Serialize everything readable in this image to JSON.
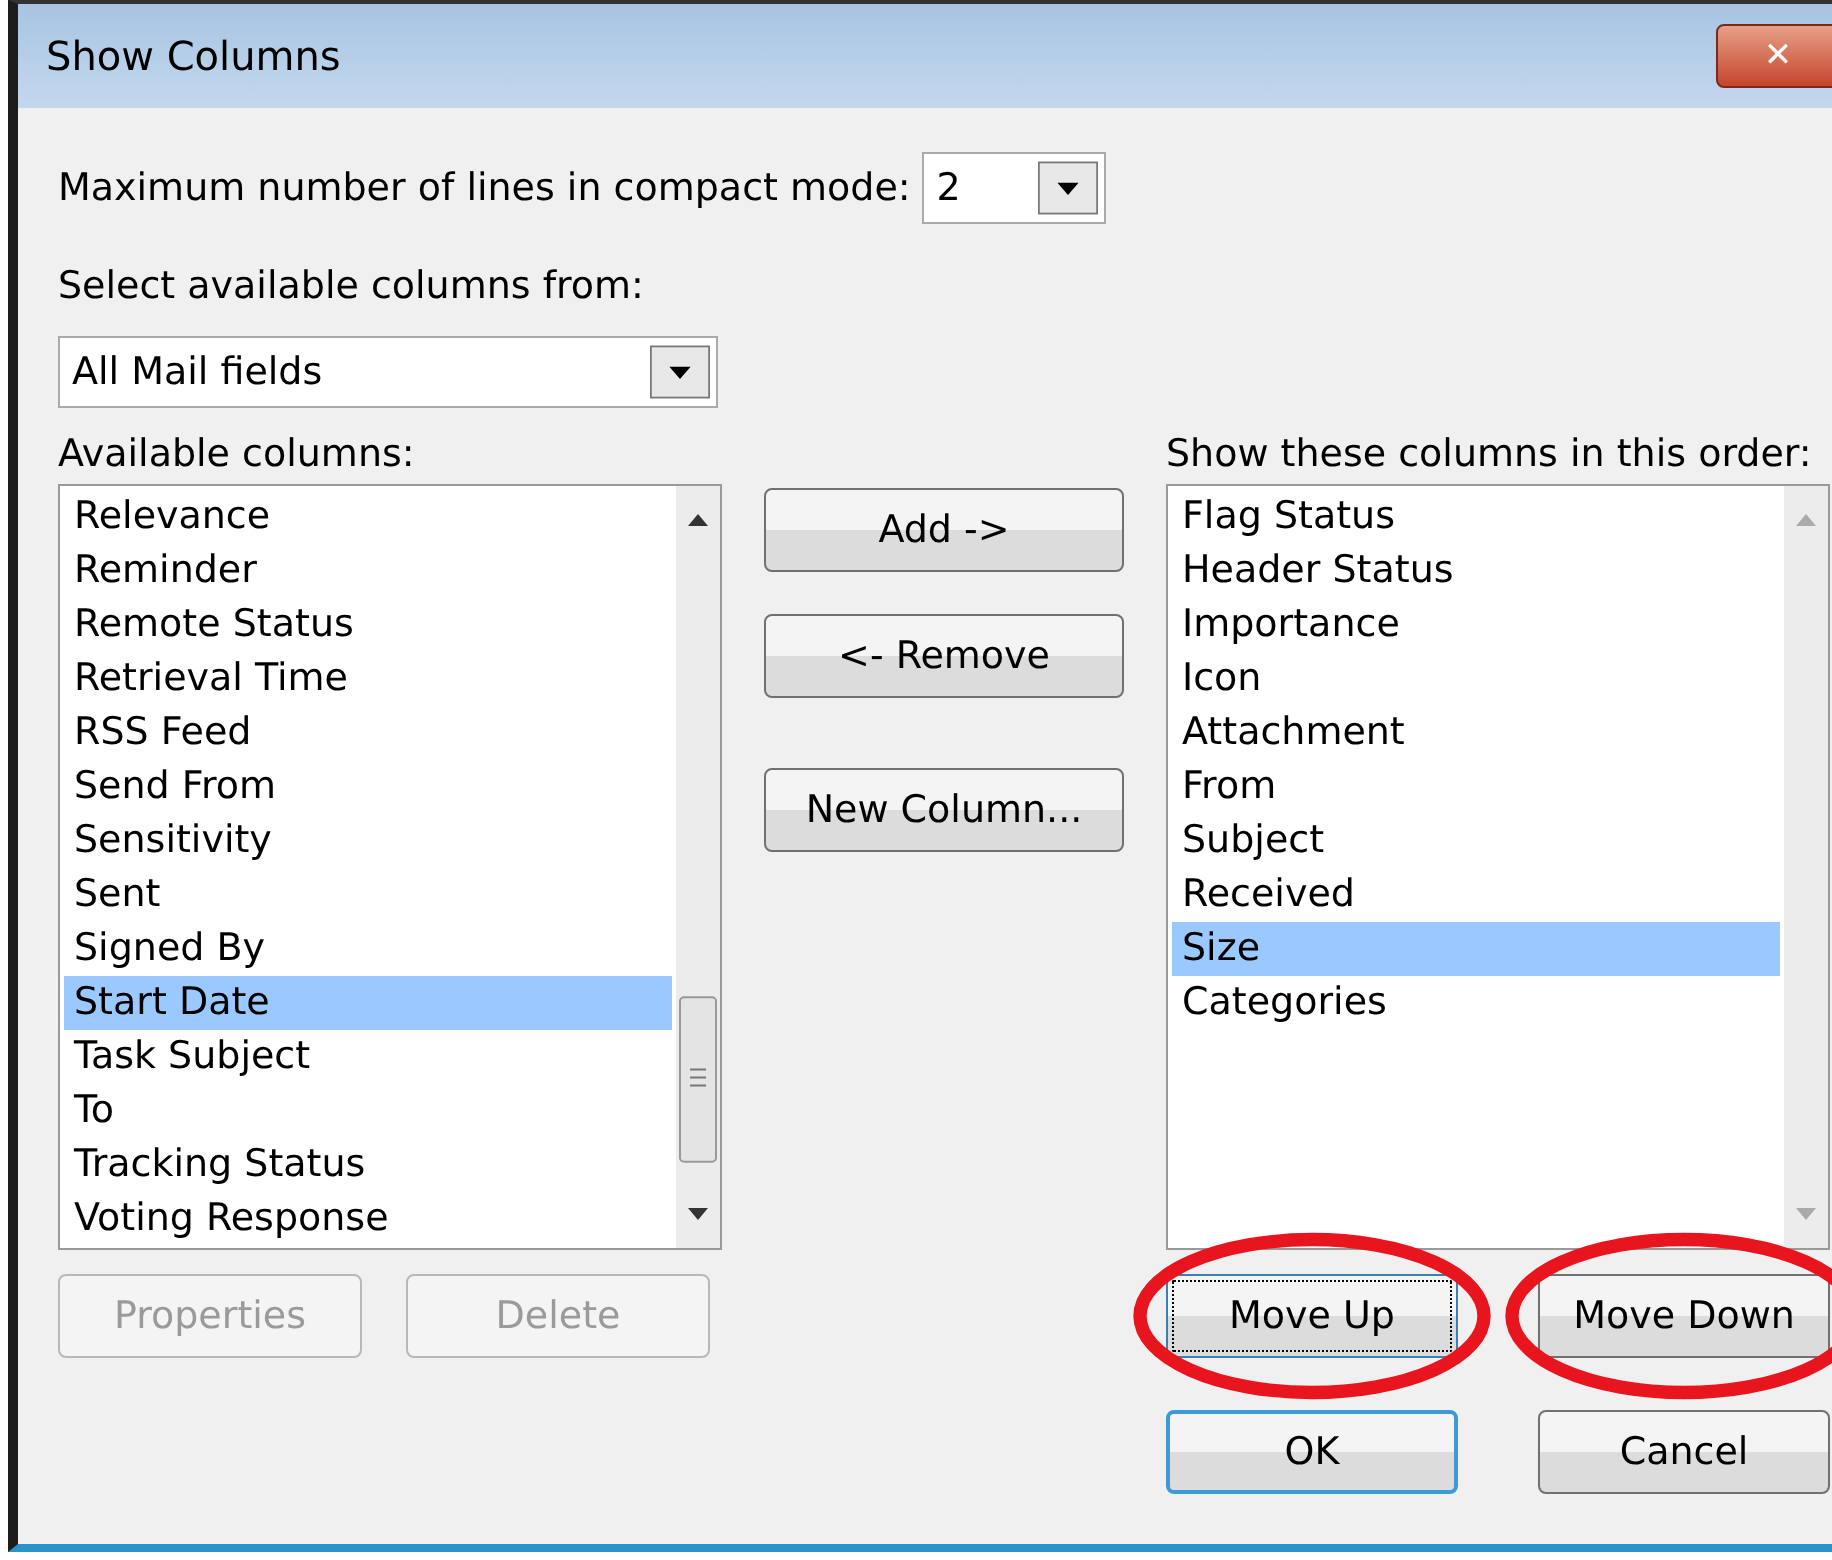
{
  "window": {
    "title": "Show Columns",
    "close": "✕"
  },
  "compact_lines": {
    "label": "Maximum number of lines in compact mode:",
    "value": "2"
  },
  "source": {
    "label": "Select available columns from:",
    "value": "All Mail fields"
  },
  "available": {
    "label": "Available columns:",
    "items": [
      {
        "label": "Relevance",
        "selected": false
      },
      {
        "label": "Reminder",
        "selected": false
      },
      {
        "label": "Remote Status",
        "selected": false
      },
      {
        "label": "Retrieval Time",
        "selected": false
      },
      {
        "label": "RSS Feed",
        "selected": false
      },
      {
        "label": "Send From",
        "selected": false
      },
      {
        "label": "Sensitivity",
        "selected": false
      },
      {
        "label": "Sent",
        "selected": false
      },
      {
        "label": "Signed By",
        "selected": false
      },
      {
        "label": "Start Date",
        "selected": true
      },
      {
        "label": "Task Subject",
        "selected": false
      },
      {
        "label": "To",
        "selected": false
      },
      {
        "label": "Tracking Status",
        "selected": false
      },
      {
        "label": "Voting Response",
        "selected": false
      }
    ]
  },
  "middle_buttons": [
    {
      "label": "Add ->"
    },
    {
      "label": "<- Remove"
    },
    {
      "label": "New Column..."
    }
  ],
  "shown": {
    "label": "Show these columns in this order:",
    "items": [
      {
        "label": "Flag Status",
        "selected": false
      },
      {
        "label": "Header Status",
        "selected": false
      },
      {
        "label": "Importance",
        "selected": false
      },
      {
        "label": "Icon",
        "selected": false
      },
      {
        "label": "Attachment",
        "selected": false
      },
      {
        "label": "From",
        "selected": false
      },
      {
        "label": "Subject",
        "selected": false
      },
      {
        "label": "Received",
        "selected": false
      },
      {
        "label": "Size",
        "selected": true
      },
      {
        "label": "Categories",
        "selected": false
      }
    ]
  },
  "left_buttons": [
    {
      "label": "Properties",
      "disabled": true
    },
    {
      "label": "Delete",
      "disabled": true
    }
  ],
  "order_buttons": [
    {
      "label": "Move Up",
      "focused": true,
      "circled": true
    },
    {
      "label": "Move Down",
      "focused": false,
      "circled": true
    }
  ],
  "footer_buttons": [
    {
      "label": "OK",
      "default": true
    },
    {
      "label": "Cancel",
      "default": false
    }
  ]
}
